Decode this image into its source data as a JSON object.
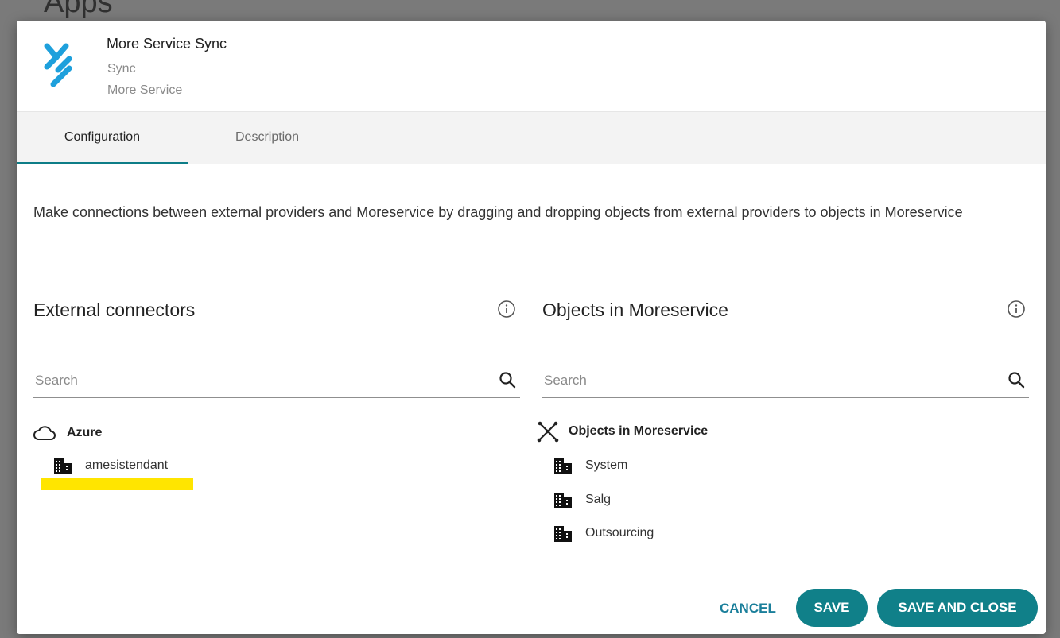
{
  "background": {
    "title": "Apps"
  },
  "app": {
    "name": "More Service Sync",
    "type": "Sync",
    "vendor": "More Service"
  },
  "tabs": [
    {
      "label": "Configuration",
      "active": true
    },
    {
      "label": "Description",
      "active": false
    }
  ],
  "intro": "Make connections between external providers and Moreservice by dragging and dropping objects from external providers to objects in Moreservice",
  "external": {
    "title": "External connectors",
    "search_placeholder": "Search",
    "root": {
      "label": "Azure",
      "icon": "cloud-icon"
    },
    "items": [
      {
        "label": "amesistendant",
        "icon": "building-icon"
      }
    ]
  },
  "moreservice": {
    "title": "Objects in Moreservice",
    "search_placeholder": "Search",
    "root": {
      "label": "Objects in Moreservice",
      "icon": "hub-icon"
    },
    "items": [
      {
        "label": "System",
        "icon": "building-icon"
      },
      {
        "label": "Salg",
        "icon": "building-icon"
      },
      {
        "label": "Outsourcing",
        "icon": "building-icon"
      }
    ]
  },
  "footer": {
    "cancel": "CANCEL",
    "save": "SAVE",
    "save_close": "SAVE AND CLOSE"
  },
  "colors": {
    "accent": "#108089",
    "link": "#1b7f9b",
    "highlight": "#ffe500",
    "logo": "#1ea0dc"
  }
}
